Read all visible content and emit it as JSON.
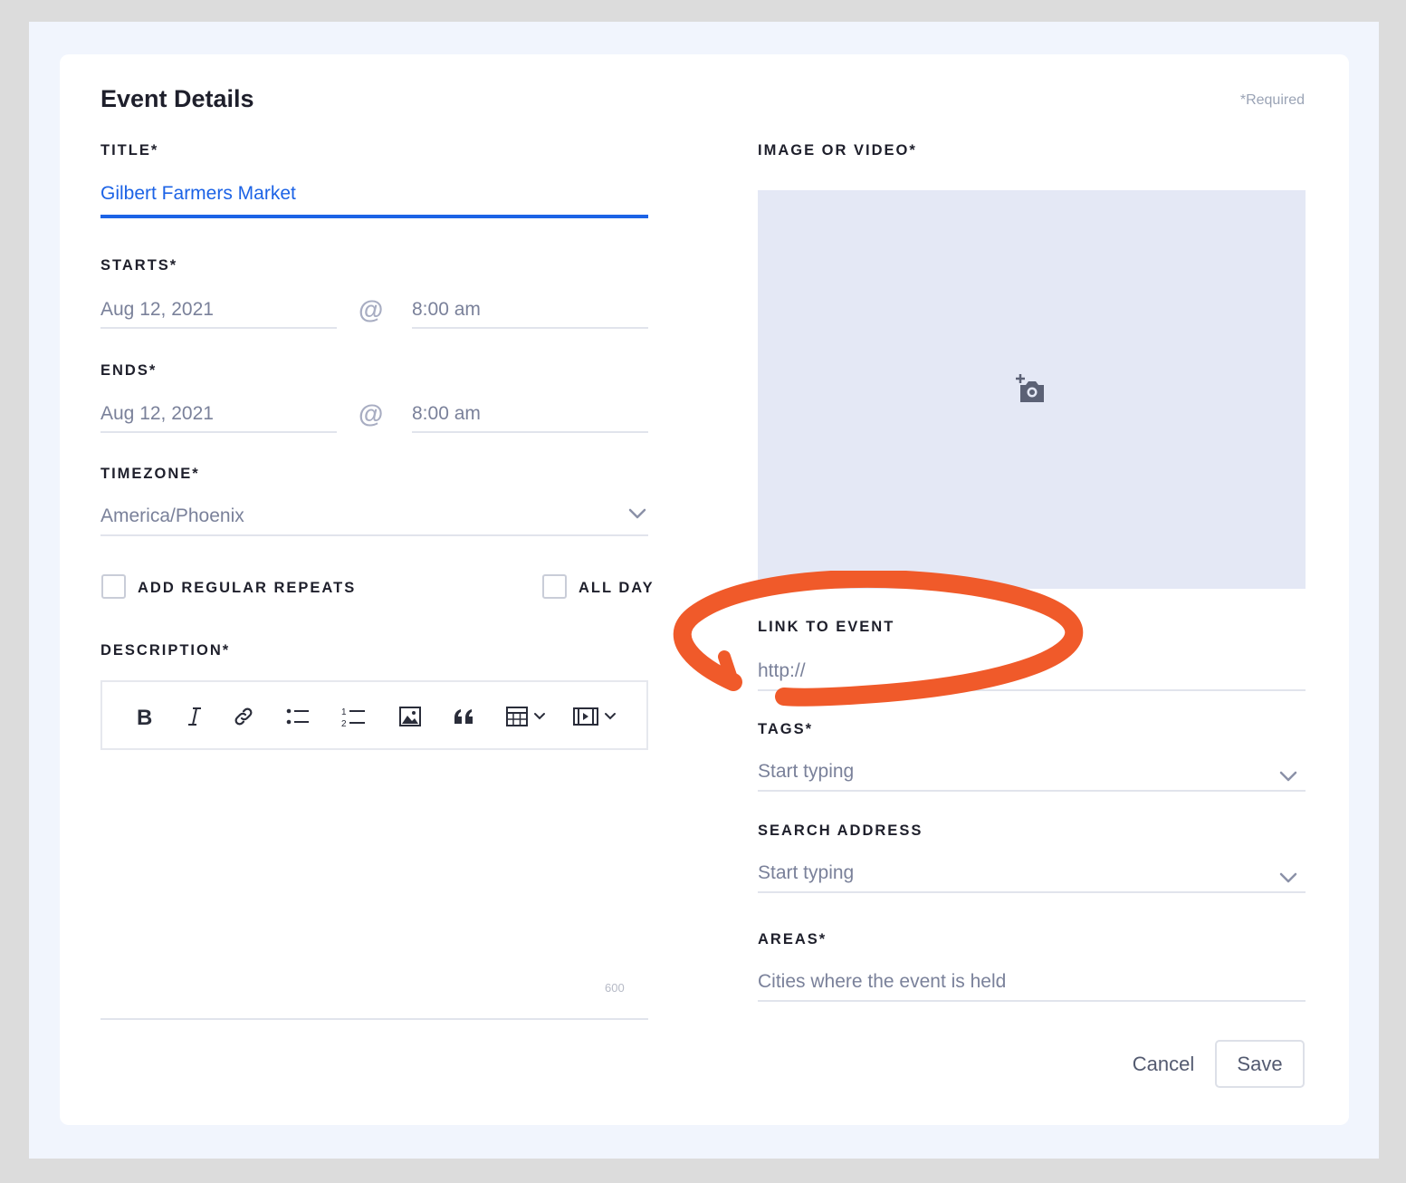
{
  "form": {
    "heading": "Event Details",
    "required_note": "*Required",
    "title": {
      "label": "TITLE*",
      "value": "Gilbert Farmers Market"
    },
    "starts": {
      "label": "STARTS*",
      "date": "Aug 12, 2021",
      "separator": "@",
      "time": "8:00 am"
    },
    "ends": {
      "label": "ENDS*",
      "date": "Aug 12, 2021",
      "separator": "@",
      "time": "8:00 am"
    },
    "timezone": {
      "label": "TIMEZONE*",
      "value": "America/Phoenix"
    },
    "repeats": {
      "label": "ADD REGULAR REPEATS",
      "checked": false
    },
    "all_day": {
      "label": "ALL DAY",
      "checked": false
    },
    "description": {
      "label": "DESCRIPTION*",
      "char_limit": "600",
      "toolbar": [
        "bold-icon",
        "italic-icon",
        "link-icon",
        "bullet-list-icon",
        "numbered-list-icon",
        "image-icon",
        "quote-icon",
        "table-icon",
        "video-icon"
      ]
    },
    "media": {
      "label": "IMAGE OR VIDEO*",
      "icon": "add-photo-icon"
    },
    "link": {
      "label": "LINK TO EVENT",
      "placeholder": "http://"
    },
    "tags": {
      "label": "TAGS*",
      "placeholder": "Start typing"
    },
    "address": {
      "label": "SEARCH ADDRESS",
      "placeholder": "Start typing"
    },
    "areas": {
      "label": "AREAS*",
      "placeholder": "Cities where the event is held"
    },
    "actions": {
      "cancel": "Cancel",
      "save": "Save"
    }
  },
  "colors": {
    "accent": "#1c63e6",
    "annotation": "#f05a2a",
    "text_dark": "#1e1f2b",
    "placeholder": "#7a819a",
    "media_bg": "#e4e8f5"
  }
}
